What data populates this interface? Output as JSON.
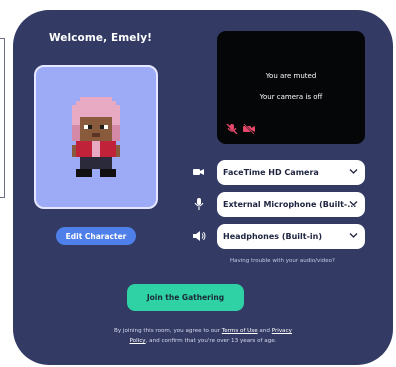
{
  "welcome": {
    "title": "Welcome, Emely!"
  },
  "character": {
    "edit_label": "Edit Character"
  },
  "video_preview": {
    "muted_text": "You are muted",
    "camera_text": "Your camera is off"
  },
  "devices": [
    {
      "kind": "camera",
      "icon": "video-camera-icon",
      "selected": "FaceTime HD Camera"
    },
    {
      "kind": "microphone",
      "icon": "microphone-icon",
      "selected": "External Microphone (Built-..."
    },
    {
      "kind": "speaker",
      "icon": "speaker-icon",
      "selected": "Headphones (Built-in)"
    }
  ],
  "help": {
    "trouble_link": "Having trouble with your audio/video?"
  },
  "join": {
    "label": "Join the Gathering"
  },
  "legal": {
    "prefix": "By joining this room, you agree to our",
    "terms_link": "Terms of Use",
    "and": "and",
    "privacy_link_1": "Privacy",
    "privacy_link_2": "Policy",
    "suffix": ", and confirm that you're over 13 years of age."
  },
  "colors": {
    "panel": "#333a64",
    "avatar_bg": "#9daaf6",
    "edit_button": "#4f7fe9",
    "join_button": "#2ed2a4",
    "muted_icon": "#e5486a"
  }
}
